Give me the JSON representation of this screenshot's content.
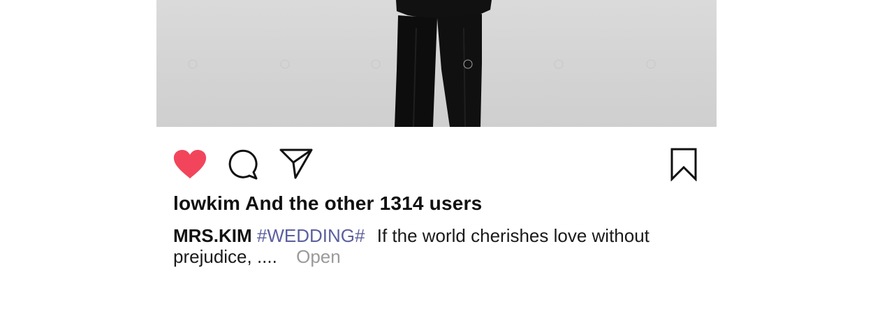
{
  "post": {
    "photo_icon": "photo-of-man-in-black-suit",
    "likes_text": "lowkim And the other 1314 users",
    "caption": {
      "username": "MRS.KIM",
      "hashtag": "#WEDDING#",
      "text_line1": "If the world cherishes love without",
      "text_line2": "prejudice, ....",
      "more_label": "Open"
    }
  },
  "actions": {
    "like_icon": "heart-icon",
    "comment_icon": "comment-bubble-icon",
    "share_icon": "paper-plane-icon",
    "save_icon": "bookmark-icon",
    "like_color": "#f2455c"
  }
}
